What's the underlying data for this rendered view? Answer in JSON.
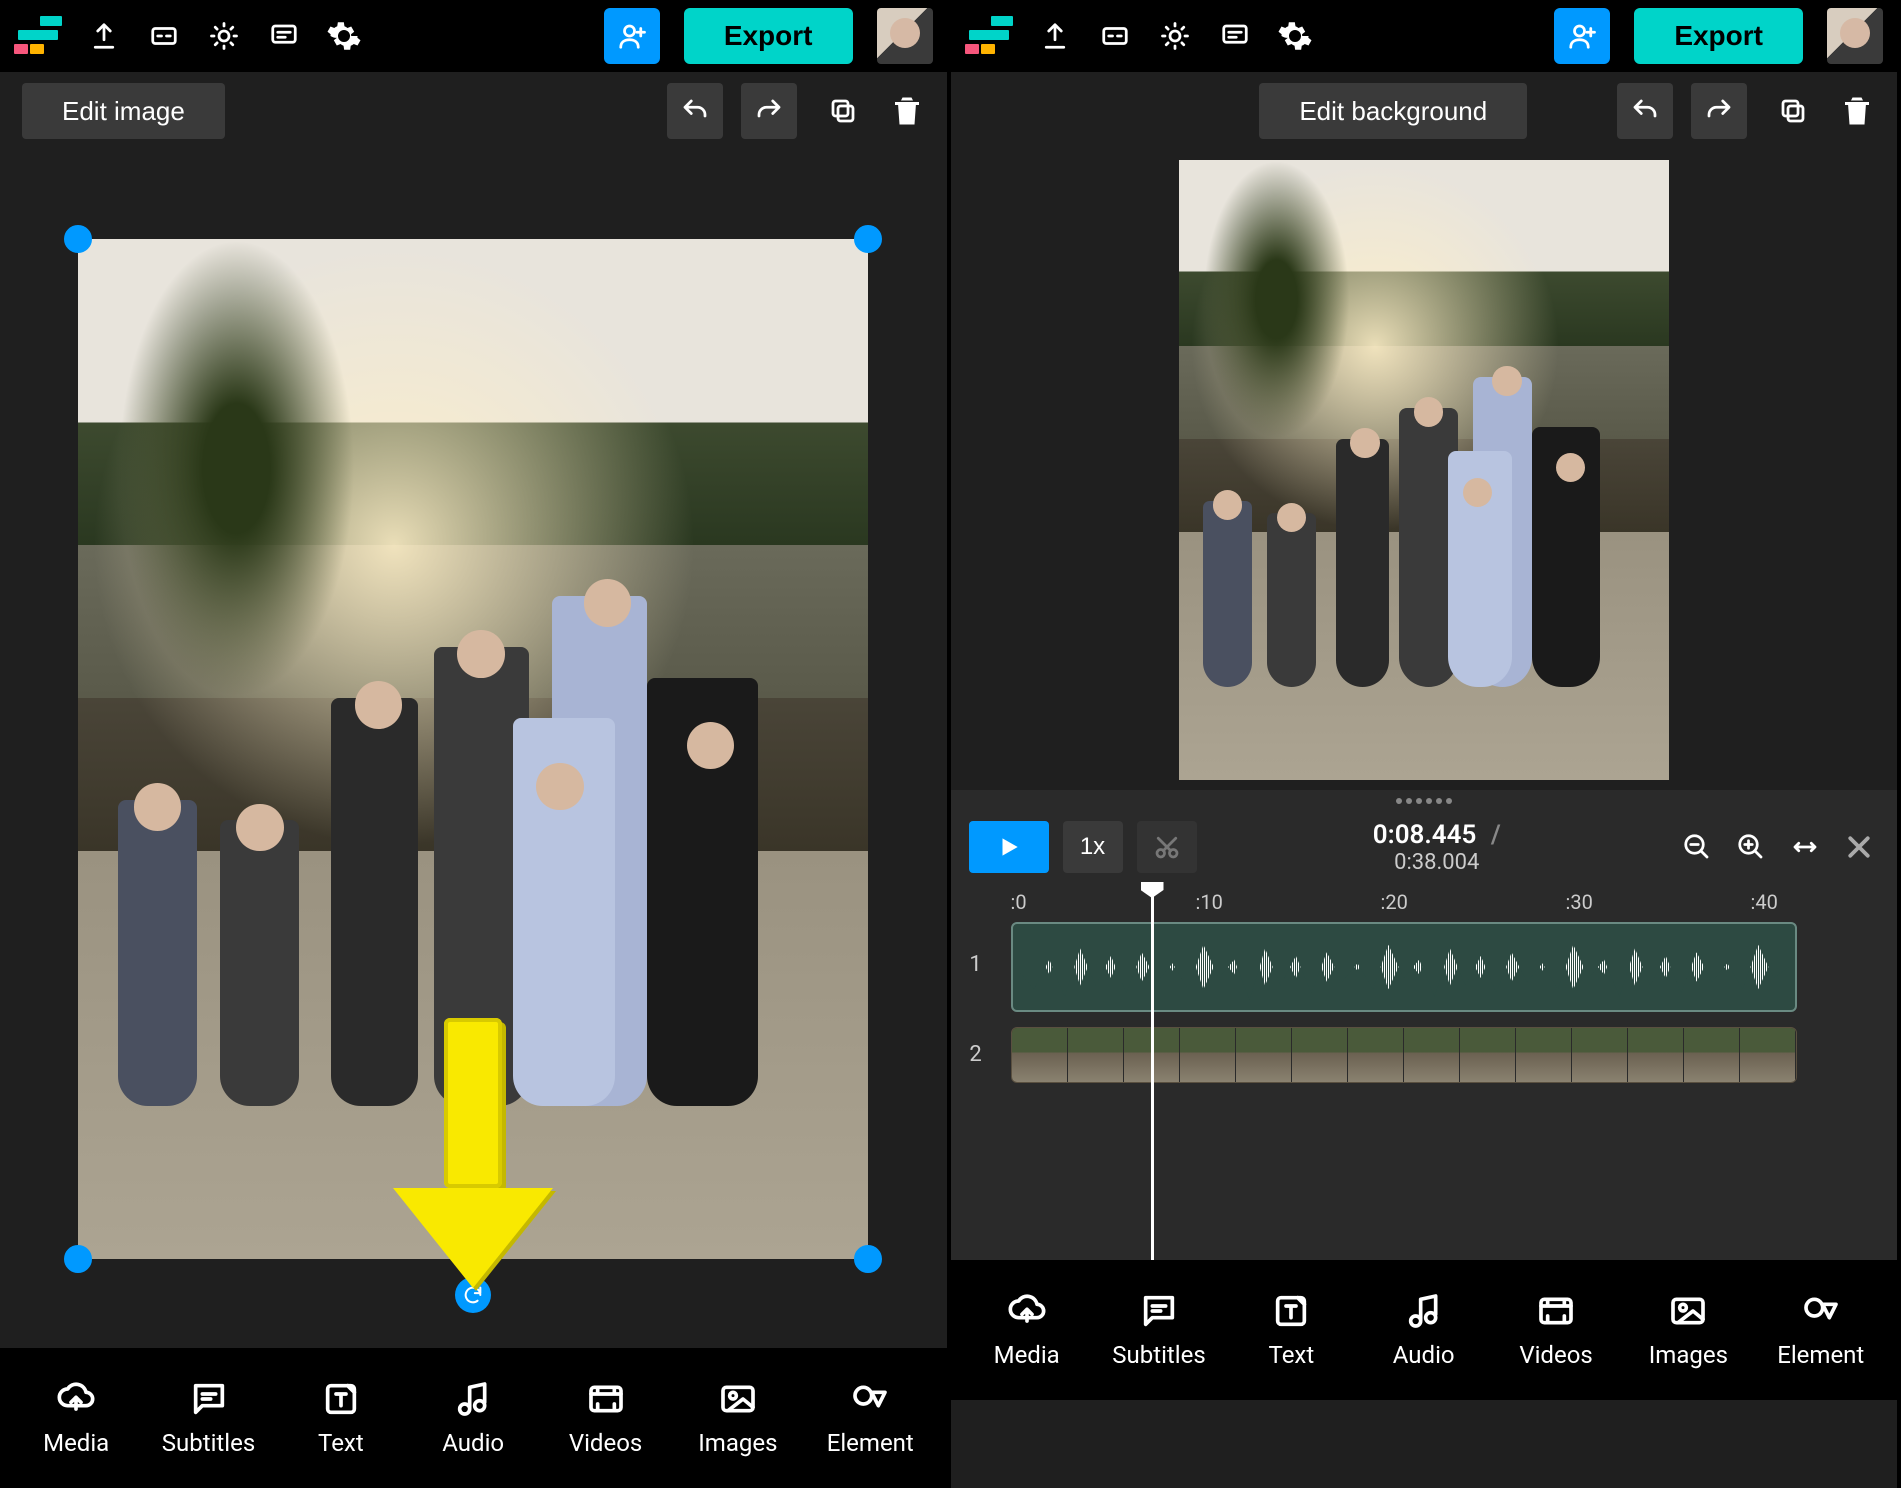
{
  "topbar": {
    "export_label": "Export"
  },
  "left": {
    "edit_button_label": "Edit image"
  },
  "right": {
    "edit_button_label": "Edit background",
    "transport": {
      "speed_label": "1x",
      "current_time": "0:08.445",
      "time_separator": "/",
      "duration": "0:38.004"
    },
    "ruler": {
      "marks": [
        ":0",
        ":10",
        ":20",
        ":30",
        ":40"
      ]
    },
    "tracks": {
      "audio_index": "1",
      "video_index": "2"
    }
  },
  "bottom_tools": [
    {
      "id": "media",
      "label": "Media"
    },
    {
      "id": "subtitles",
      "label": "Subtitles"
    },
    {
      "id": "text",
      "label": "Text"
    },
    {
      "id": "audio",
      "label": "Audio"
    },
    {
      "id": "videos",
      "label": "Videos"
    },
    {
      "id": "images",
      "label": "Images"
    },
    {
      "id": "elements",
      "label": "Element"
    }
  ],
  "colors": {
    "accent_teal": "#00d4c9",
    "accent_blue": "#0099ff",
    "annotation_yellow": "#f9e900"
  }
}
